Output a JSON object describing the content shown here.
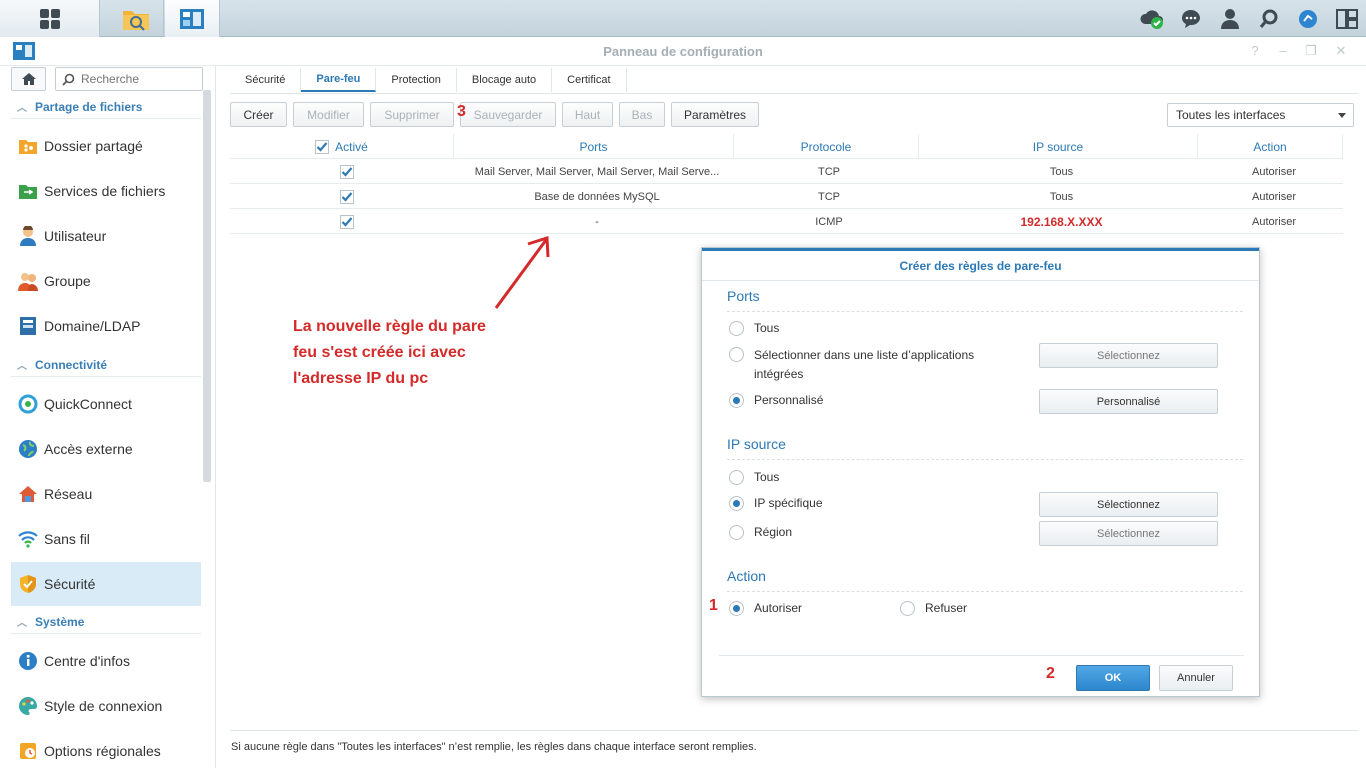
{
  "window": {
    "title": "Panneau de configuration"
  },
  "sidebar": {
    "search_placeholder": "Recherche",
    "sections": [
      {
        "label": "Partage de fichiers"
      },
      {
        "label": "Connectivité"
      },
      {
        "label": "Système"
      }
    ],
    "items": [
      {
        "label": "Dossier partagé",
        "icon": "shared-folder-icon"
      },
      {
        "label": "Services de fichiers",
        "icon": "file-services-icon"
      },
      {
        "label": "Utilisateur",
        "icon": "user-icon"
      },
      {
        "label": "Groupe",
        "icon": "group-icon"
      },
      {
        "label": "Domaine/LDAP",
        "icon": "domain-icon"
      },
      {
        "label": "QuickConnect",
        "icon": "quickconnect-icon"
      },
      {
        "label": "Accès externe",
        "icon": "globe-icon"
      },
      {
        "label": "Réseau",
        "icon": "network-icon"
      },
      {
        "label": "Sans fil",
        "icon": "wifi-icon"
      },
      {
        "label": "Sécurité",
        "icon": "shield-icon",
        "active": true
      },
      {
        "label": "Centre d'infos",
        "icon": "info-icon"
      },
      {
        "label": "Style de connexion",
        "icon": "palette-icon"
      },
      {
        "label": "Options régionales",
        "icon": "regional-icon"
      }
    ]
  },
  "tabs": [
    "Sécurité",
    "Pare-feu",
    "Protection",
    "Blocage auto",
    "Certificat"
  ],
  "active_tab": "Pare-feu",
  "toolbar": {
    "create": "Créer",
    "edit": "Modifier",
    "delete": "Supprimer",
    "save": "Sauvegarder",
    "up": "Haut",
    "down": "Bas",
    "settings": "Paramètres",
    "interface_select": "Toutes les interfaces"
  },
  "table": {
    "columns": [
      "Activé",
      "Ports",
      "Protocole",
      "IP source",
      "Action"
    ],
    "rows": [
      {
        "enabled": true,
        "ports": "Mail Server, Mail Server, Mail Server, Mail Serve...",
        "protocol": "TCP",
        "source_ip": "Tous",
        "action": "Autoriser"
      },
      {
        "enabled": true,
        "ports": "Base de données MySQL",
        "protocol": "TCP",
        "source_ip": "Tous",
        "action": "Autoriser"
      },
      {
        "enabled": true,
        "ports": "-",
        "protocol": "ICMP",
        "source_ip": "192.168.X.XXX",
        "action": "Autoriser"
      }
    ]
  },
  "annotation": {
    "note_lines": [
      "La nouvelle règle du pare",
      "feu s'est créée ici avec",
      "l'adresse IP du pc"
    ],
    "step1": "1",
    "step2": "2",
    "step3": "3",
    "color": "#d42a2a"
  },
  "footer_note": "Si aucune règle dans \"Toutes les interfaces\" n’est remplie, les règles dans chaque interface seront remplies.",
  "dialog": {
    "title": "Créer des règles de pare-feu",
    "ports_section": "Ports",
    "ports_options": {
      "all": "Tous",
      "select_list_line1": "Sélectionner dans une liste d’applications",
      "select_list_line2": "intégrées",
      "custom": "Personnalisé"
    },
    "ports_selected": "custom",
    "ports_buttons": {
      "select": "Sélectionnez",
      "custom": "Personnalisé"
    },
    "source_section": "IP source",
    "source_options": {
      "all": "Tous",
      "specific": "IP spécifique",
      "region": "Région"
    },
    "source_selected": "specific",
    "source_buttons": {
      "specific": "Sélectionnez",
      "region": "Sélectionnez"
    },
    "action_section": "Action",
    "action_options": {
      "allow": "Autoriser",
      "deny": "Refuser"
    },
    "action_selected": "allow",
    "ok": "OK",
    "cancel": "Annuler"
  },
  "colors": {
    "accent": "#2d79b5",
    "active_bg": "#d8ebf7"
  }
}
